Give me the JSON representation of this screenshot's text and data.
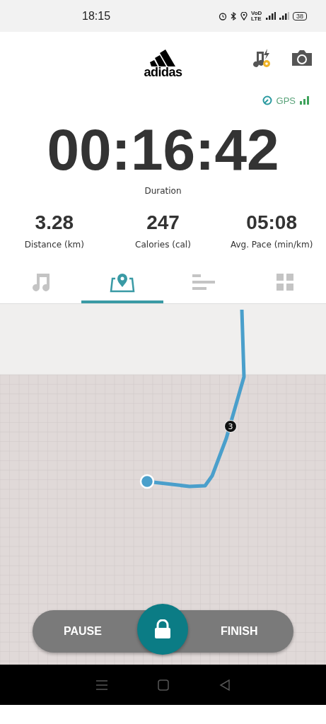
{
  "status_bar": {
    "time": "18:15",
    "network": "VoD LTE",
    "battery": "38"
  },
  "header": {
    "logo": "adidas"
  },
  "gps": {
    "label": "GPS"
  },
  "timer": {
    "value": "00:16:42",
    "label": "Duration"
  },
  "stats": [
    {
      "value": "3.28",
      "label": "Distance (km)"
    },
    {
      "value": "247",
      "label": "Calories (cal)"
    },
    {
      "value": "05:08",
      "label": "Avg. Pace (min/km)"
    }
  ],
  "tabs": [
    {
      "kind": "music",
      "selected": false
    },
    {
      "kind": "map",
      "selected": true
    },
    {
      "kind": "stats",
      "selected": false
    },
    {
      "kind": "grid",
      "selected": false
    }
  ],
  "map": {
    "km_marker": "3"
  },
  "controls": {
    "pause": "PAUSE",
    "finish": "FINISH"
  }
}
